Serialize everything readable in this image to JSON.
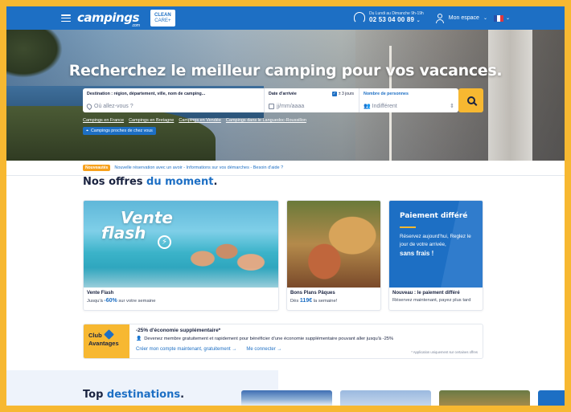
{
  "header": {
    "logo": "campings",
    "logo_sub": ".com",
    "clean_line1": "CLEAN",
    "clean_line2": "CARE+",
    "phone_hours": "Du Lundi au Dimanche 9h-19h",
    "phone_number": "02 53 04 00 89",
    "account_label": "Mon espace",
    "language": "FR",
    "colors": {
      "primary": "#1d6fc4",
      "accent": "#f7b831"
    }
  },
  "hero": {
    "title": "Recherchez le meilleur camping pour vos vacances.",
    "destination_label": "Destination : région, département, ville, nom de camping...",
    "destination_placeholder": "Où allez-vous ?",
    "date_label": "Date d'arrivée",
    "date_flex": "± 3 jours",
    "date_placeholder": "jj/mm/aaaa",
    "persons_label": "Nombre de personnes",
    "persons_value": "Indifférent",
    "quick_links": [
      "Campings en France",
      "Campings en Bretagne",
      "Campings en Vendée",
      "Campings dans le Languedoc-Roussillon"
    ],
    "nearby_label": "Campings proches de chez vous"
  },
  "news": {
    "badge": "Nouveautés",
    "message": "Nouvelle réservation avec un avoir - Informations sur vos démarches - Besoin d'aide ?"
  },
  "offers": {
    "heading_main": "Nos offres",
    "heading_highlight": "du moment",
    "heading_end": ".",
    "cards": [
      {
        "title": "Vente Flash",
        "sub_prefix": "Jusqu'à ",
        "sub_value": "-60%",
        "sub_suffix": " sur votre semaine",
        "banner_1": "Vente",
        "banner_2": "flash"
      },
      {
        "title": "Bons Plans Pâques",
        "sub_prefix": "Dès ",
        "sub_value": "119€",
        "sub_suffix": " la semaine!"
      },
      {
        "title": "Nouveau : le paiement différé",
        "sub_prefix": "Réservez maintenant, payez plus tard",
        "sub_value": "",
        "sub_suffix": "",
        "banner_title": "Paiement différé",
        "banner_body": "Réservez aujourd'hui, Reglez le jour de votre arrivée,",
        "banner_strong": "sans frais !"
      }
    ]
  },
  "club": {
    "logo_line1": "Club",
    "logo_line2": "Avantages",
    "title": "-25% d'économie supplémentaire*",
    "desc": "Devenez membre gratuitement et rapidement pour bénéficier d'une économie supplémentaire pouvant aller jusqu'à -25%",
    "link_create": "Créer mon compte maintenant, gratuitement",
    "link_login": "Me connecter",
    "note": "* Application uniquement sur certaines offres"
  },
  "destinations": {
    "heading_main": "Top",
    "heading_highlight": "destinations",
    "heading_end": "."
  }
}
